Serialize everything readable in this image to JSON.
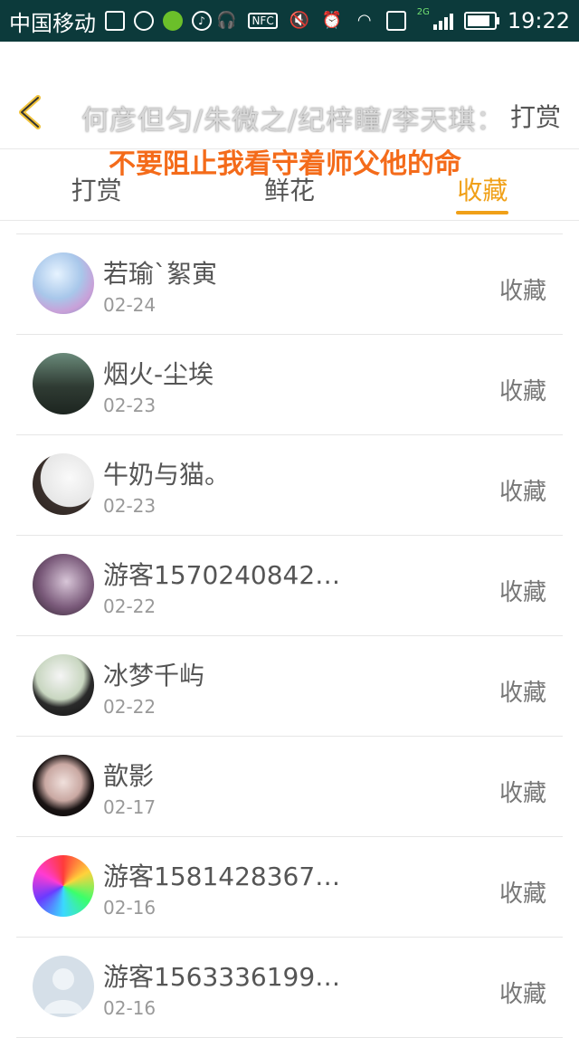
{
  "status_bar": {
    "carrier": "中国移动",
    "nfc": "NFC",
    "network": "2G",
    "time": "19:22"
  },
  "header": {
    "title": "何彦但匀/朱微之/纪梓瞳/李天琪：",
    "right": "打赏",
    "subtitle": "不要阻止我看守着师父他的命"
  },
  "tabs": [
    {
      "label": "打赏",
      "active": false
    },
    {
      "label": "鲜花",
      "active": false
    },
    {
      "label": "收藏",
      "active": true
    }
  ],
  "list": [
    {
      "name": "若瑜`絮寅",
      "date": "02-24",
      "action": "收藏"
    },
    {
      "name": "烟火-尘埃",
      "date": "02-23",
      "action": "收藏"
    },
    {
      "name": "牛奶与猫。",
      "date": "02-23",
      "action": "收藏"
    },
    {
      "name": "游客1570240842…",
      "date": "02-22",
      "action": "收藏"
    },
    {
      "name": "冰梦千屿",
      "date": "02-22",
      "action": "收藏"
    },
    {
      "name": "歆影",
      "date": "02-17",
      "action": "收藏"
    },
    {
      "name": "游客1581428367…",
      "date": "02-16",
      "action": "收藏"
    },
    {
      "name": "游客1563336199…",
      "date": "02-16",
      "action": "收藏"
    }
  ],
  "colors": {
    "accent": "#f0a018",
    "statusbar": "#0c3a3b",
    "subtitle": "#f46b1a"
  }
}
